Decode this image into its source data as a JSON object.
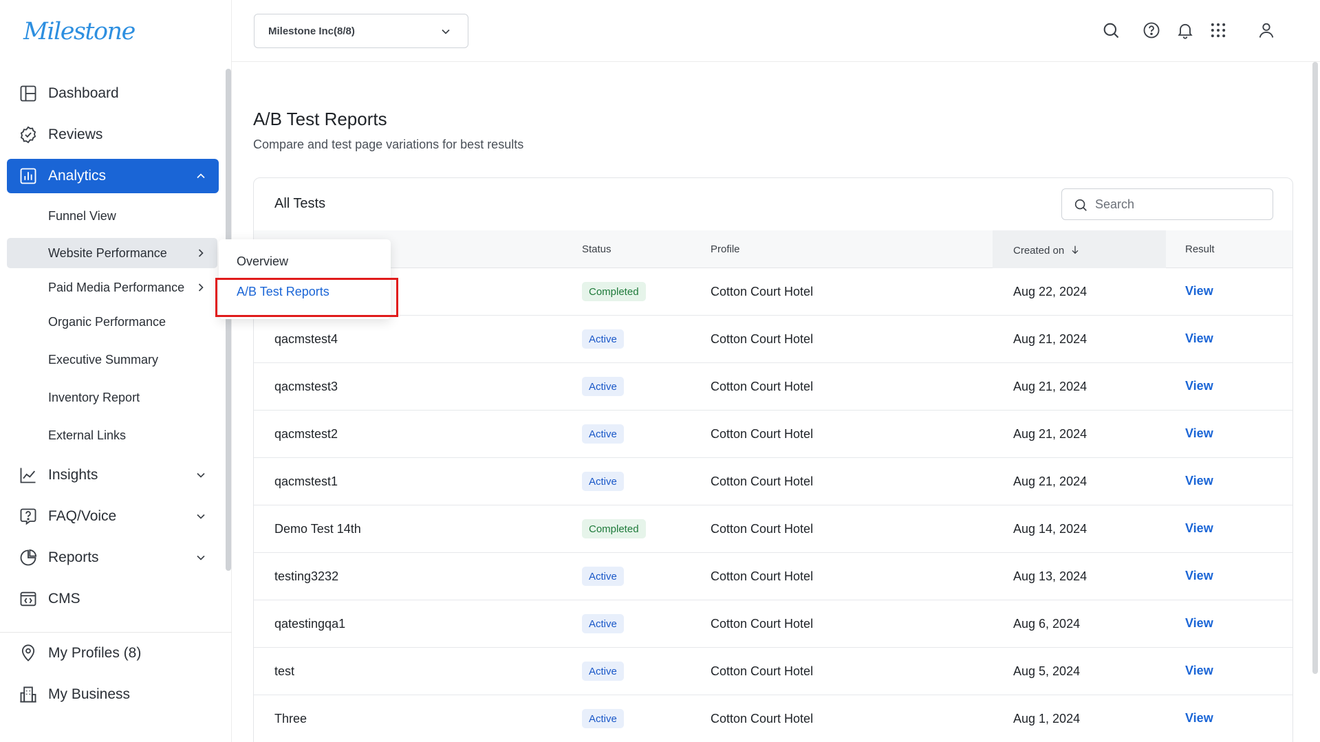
{
  "brand": {
    "logo_text": "Milestone",
    "accent": "#1a65d6",
    "logo_color": "#2d8fe0"
  },
  "sidebar": {
    "items": [
      {
        "label": "Dashboard",
        "icon": "layout-icon"
      },
      {
        "label": "Reviews",
        "icon": "badge-check-icon"
      },
      {
        "label": "Analytics",
        "icon": "bar-chart-icon",
        "active": true,
        "expanded": true
      },
      {
        "label": "Insights",
        "icon": "line-chart-icon"
      },
      {
        "label": "FAQ/Voice",
        "icon": "question-bubble-icon"
      },
      {
        "label": "Reports",
        "icon": "pie-chart-icon"
      },
      {
        "label": "CMS",
        "icon": "code-window-icon"
      }
    ],
    "analytics_subitems": [
      {
        "label": "Funnel View"
      },
      {
        "label": "Website Performance",
        "has_submenu": true
      },
      {
        "label": "Paid Media Performance",
        "has_submenu": true
      },
      {
        "label": "Organic Performance"
      },
      {
        "label": "Executive Summary"
      },
      {
        "label": "Inventory Report"
      },
      {
        "label": "External Links"
      }
    ],
    "bottom_items": [
      {
        "label": "My Profiles (8)",
        "icon": "location-pin-icon"
      },
      {
        "label": "My Business",
        "icon": "building-icon"
      }
    ]
  },
  "flyout": {
    "items": [
      {
        "label": "Overview"
      },
      {
        "label": "A/B Test Reports",
        "selected": true
      }
    ]
  },
  "header": {
    "org_selector": "Milestone Inc(8/8)",
    "icons": [
      "search-icon",
      "help-icon",
      "bell-icon",
      "apps-grid-icon",
      "user-icon"
    ]
  },
  "page": {
    "title": "A/B Test Reports",
    "subtitle": "Compare and test page variations for best results"
  },
  "tests": {
    "card_title": "All Tests",
    "search_placeholder": "Search",
    "columns": {
      "status": "Status",
      "profile": "Profile",
      "created_on": "Created on",
      "result": "Result"
    },
    "rows": [
      {
        "name": "",
        "status": "Completed",
        "profile": "Cotton Court Hotel",
        "created": "Aug 22, 2024",
        "result": "View"
      },
      {
        "name": "qacmstest4",
        "status": "Active",
        "profile": "Cotton Court Hotel",
        "created": "Aug 21, 2024",
        "result": "View"
      },
      {
        "name": "qacmstest3",
        "status": "Active",
        "profile": "Cotton Court Hotel",
        "created": "Aug 21, 2024",
        "result": "View"
      },
      {
        "name": "qacmstest2",
        "status": "Active",
        "profile": "Cotton Court Hotel",
        "created": "Aug 21, 2024",
        "result": "View"
      },
      {
        "name": "qacmstest1",
        "status": "Active",
        "profile": "Cotton Court Hotel",
        "created": "Aug 21, 2024",
        "result": "View"
      },
      {
        "name": "Demo Test 14th",
        "status": "Completed",
        "profile": "Cotton Court Hotel",
        "created": "Aug 14, 2024",
        "result": "View"
      },
      {
        "name": "testing3232",
        "status": "Active",
        "profile": "Cotton Court Hotel",
        "created": "Aug 13, 2024",
        "result": "View"
      },
      {
        "name": "qatestingqa1",
        "status": "Active",
        "profile": "Cotton Court Hotel",
        "created": "Aug 6, 2024",
        "result": "View"
      },
      {
        "name": "test",
        "status": "Active",
        "profile": "Cotton Court Hotel",
        "created": "Aug 5, 2024",
        "result": "View"
      },
      {
        "name": "Three",
        "status": "Active",
        "profile": "Cotton Court Hotel",
        "created": "Aug 1, 2024",
        "result": "View"
      }
    ]
  }
}
